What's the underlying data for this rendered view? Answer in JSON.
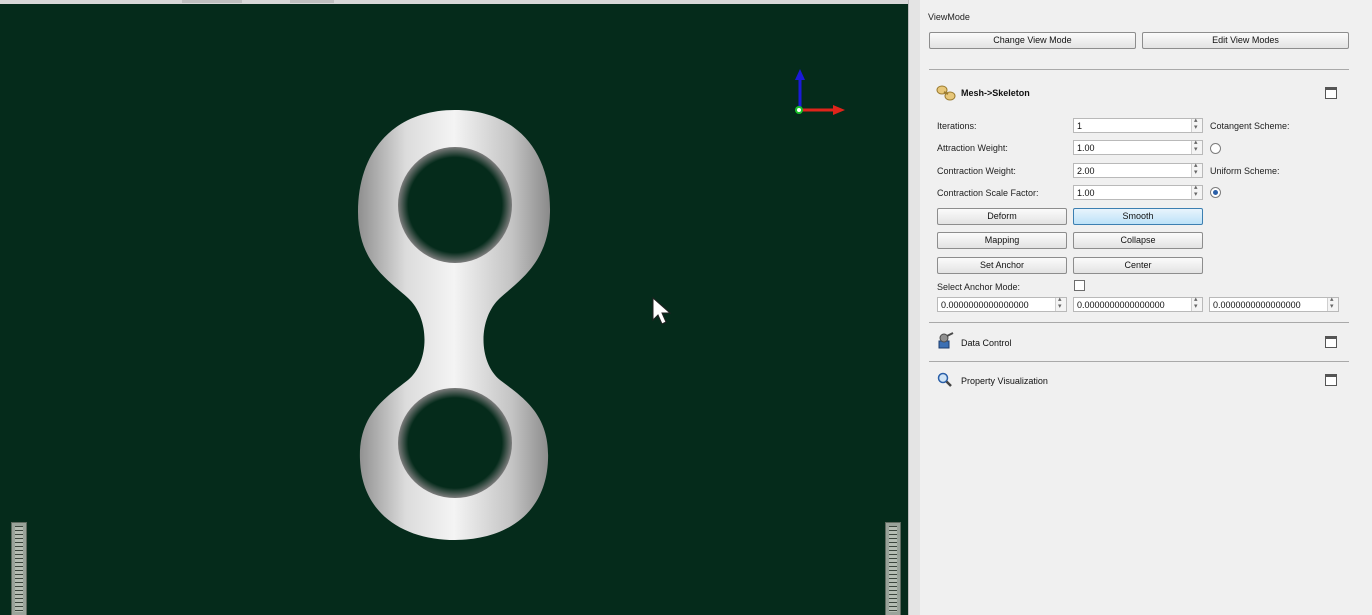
{
  "panel": {
    "viewmode": {
      "label": "ViewMode",
      "change_button": "Change View Mode",
      "edit_button": "Edit View Modes"
    },
    "skeleton": {
      "title": "Mesh->Skeleton",
      "iterations_label": "Iterations:",
      "iterations_value": "1",
      "attraction_label": "Attraction Weight:",
      "attraction_value": "1.00",
      "contraction_label": "Contraction Weight:",
      "contraction_value": "2.00",
      "scale_label": "Contraction Scale Factor:",
      "scale_value": "1.00",
      "cotangent_label": "Cotangent Scheme:",
      "uniform_label": "Uniform Scheme:",
      "selected_scheme": "Uniform Scheme",
      "buttons": {
        "deform": "Deform",
        "smooth": "Smooth",
        "mapping": "Mapping",
        "collapse": "Collapse",
        "set_anchor": "Set Anchor",
        "center": "Center"
      },
      "anchor_mode_label": "Select Anchor Mode:",
      "anchor_mode_checked": false,
      "coords": [
        "0.0000000000000000",
        "0.0000000000000000",
        "0.0000000000000000"
      ]
    },
    "data_control": {
      "title": "Data Control"
    },
    "property_visualization": {
      "title": "Property Visualization"
    }
  },
  "colors": {
    "viewport_bg": "#052b1b",
    "axis_x": "#e0241b",
    "axis_y": "#1a1ad8",
    "axis_origin": "#19c22a",
    "button_active": "#bde2f8"
  }
}
